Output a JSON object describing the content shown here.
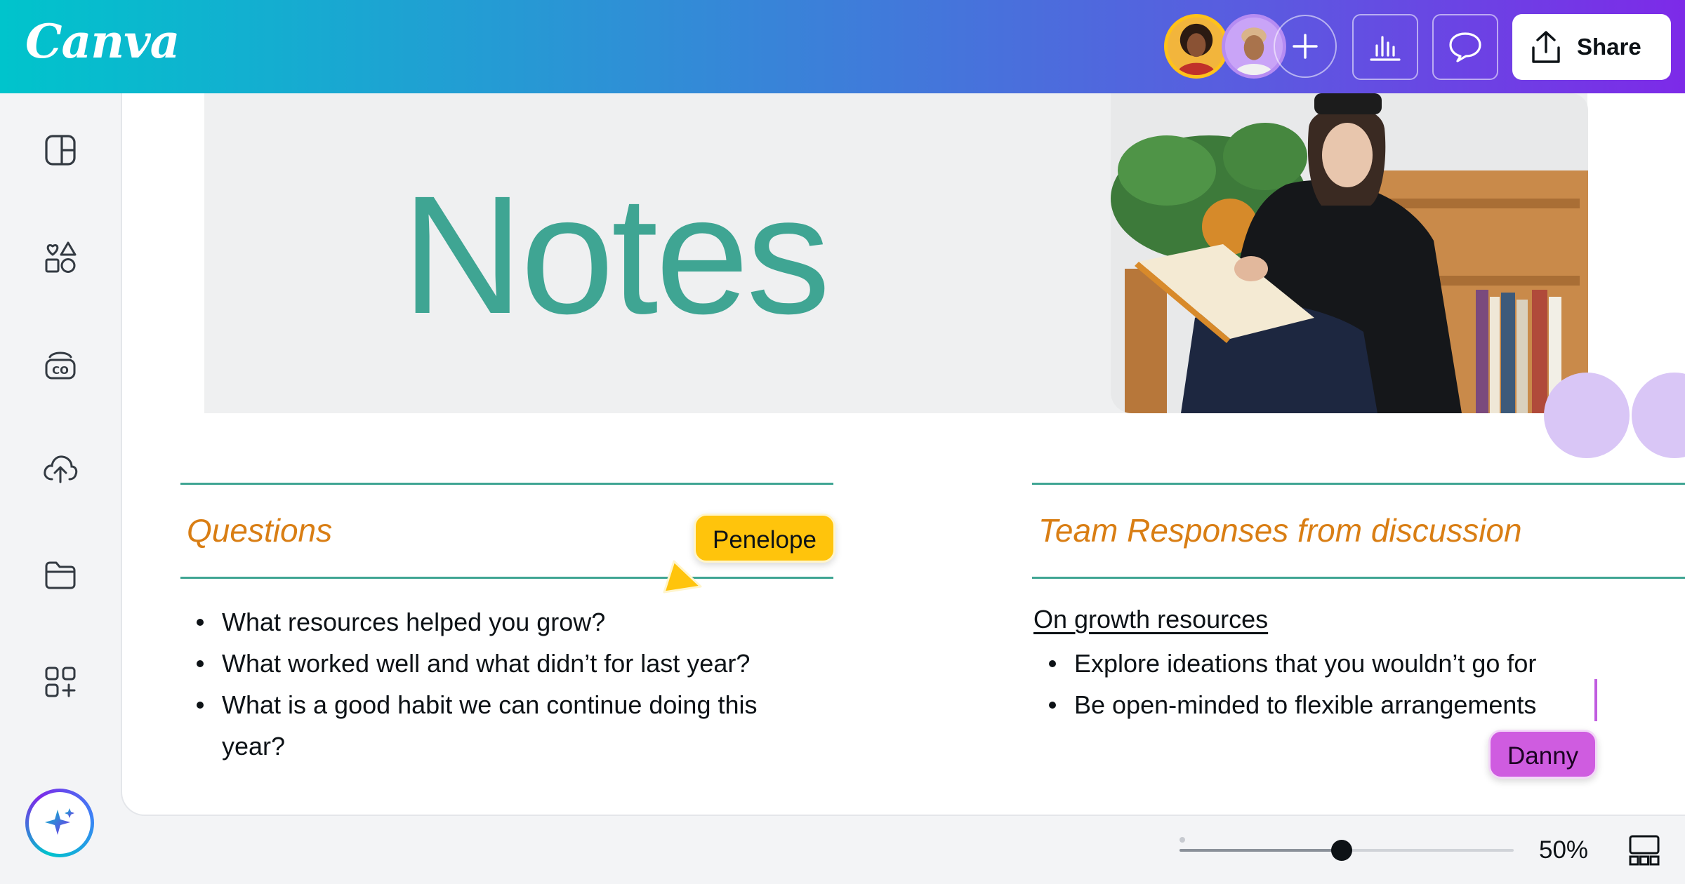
{
  "app": {
    "logo_text": "Canva"
  },
  "topbar": {
    "collaborators": [
      {
        "name": "collaborator-1",
        "ring_color": "#ffc21a"
      },
      {
        "name": "collaborator-2",
        "ring_color": "#b68cf2"
      }
    ],
    "add_icon": "plus-icon",
    "insights_icon": "bar-chart-icon",
    "comment_icon": "comment-icon",
    "share_icon": "upload-icon",
    "share_label": "Share"
  },
  "sidebar": {
    "items": [
      {
        "icon": "design-icon"
      },
      {
        "icon": "elements-icon"
      },
      {
        "icon": "brand-icon"
      },
      {
        "icon": "uploads-icon"
      },
      {
        "icon": "projects-icon"
      },
      {
        "icon": "apps-icon"
      }
    ],
    "magic_icon": "sparkle-icon"
  },
  "document": {
    "title": "Notes",
    "left_section": {
      "heading": "Questions",
      "bullets": [
        "What resources helped you grow?",
        "What worked well and what didn’t for last year?",
        "What is a good habit we can continue doing this year?"
      ]
    },
    "right_section": {
      "heading": "Team Responses from discussion",
      "subheading": "On growth resources",
      "bullets": [
        "Explore ideations that you wouldn’t go for",
        "Be open-minded to flexible arrangements"
      ]
    }
  },
  "cursors": {
    "penelope": {
      "label": "Penelope",
      "color": "#ffc40c"
    },
    "danny": {
      "label": "Danny",
      "color": "#cf5ce0"
    }
  },
  "bottombar": {
    "zoom_label": "50%",
    "zoom_value": 0.5
  },
  "colors": {
    "accent_teal": "#3fa593",
    "heading_orange": "#d97e14"
  }
}
